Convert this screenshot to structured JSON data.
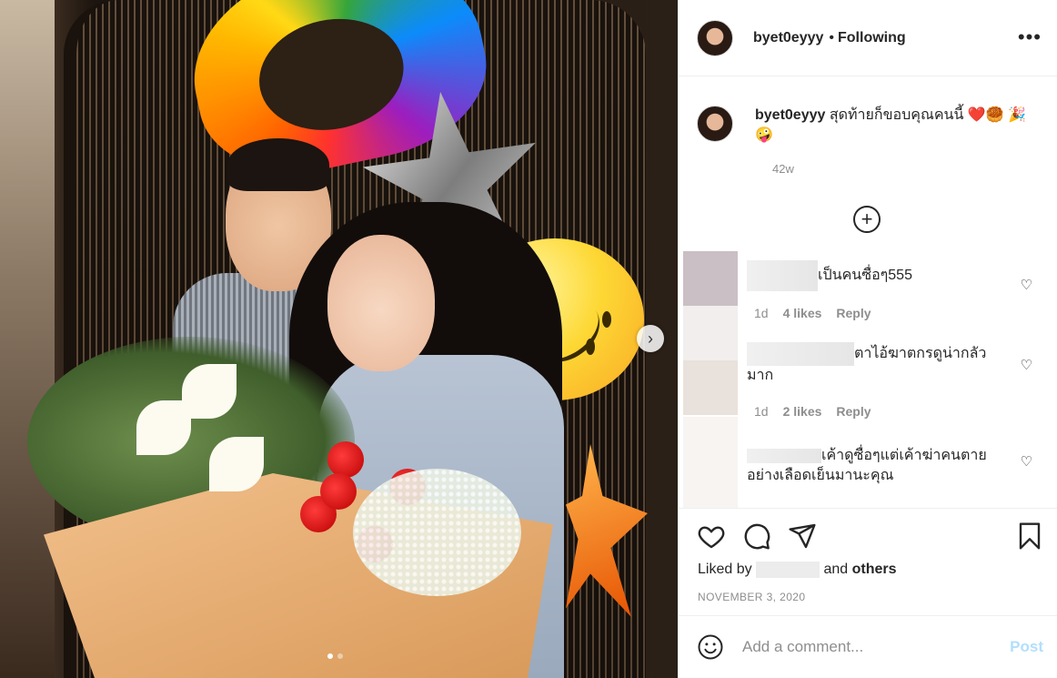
{
  "post": {
    "username": "byet0eyyy",
    "separator": "•",
    "follow_status": "Following",
    "more_label": "•••",
    "caption_username": "byet0eyyy",
    "caption_text": " สุดท้ายก็ขอบคุณคนนี้ ❤️🥮 🎉 🤪",
    "caption_time": "42w",
    "load_more_label": "+",
    "carousel_next_label": "›",
    "liked_by_prefix": "Liked by ",
    "liked_by_mid": " and ",
    "liked_by_others": "others",
    "date": "NOVEMBER 3, 2020"
  },
  "comments": [
    {
      "text": "เป็นคนซื่อๆ555",
      "time": "1d",
      "likes": "4 likes",
      "reply": "Reply"
    },
    {
      "text": "ตาไอ้ฆาตกรดูน่ากลัวมาก",
      "time": "1d",
      "likes": "2 likes",
      "reply": "Reply"
    },
    {
      "text": "เค้าดูซื่อๆแต่เค้าฆ่าคนตายอย่างเลือดเย็นมานะคุณ"
    }
  ],
  "add_comment": {
    "placeholder": "Add a comment...",
    "post_label": "Post"
  },
  "colors": {
    "text": "#262626",
    "secondary": "#8e8e8e",
    "post_disabled": "#b2dffc",
    "divider": "#efefef"
  },
  "icons": [
    "more-icon",
    "plus-circle-icon",
    "heart-icon",
    "comment-icon",
    "share-icon",
    "bookmark-icon",
    "emoji-icon",
    "chevron-right-icon"
  ]
}
